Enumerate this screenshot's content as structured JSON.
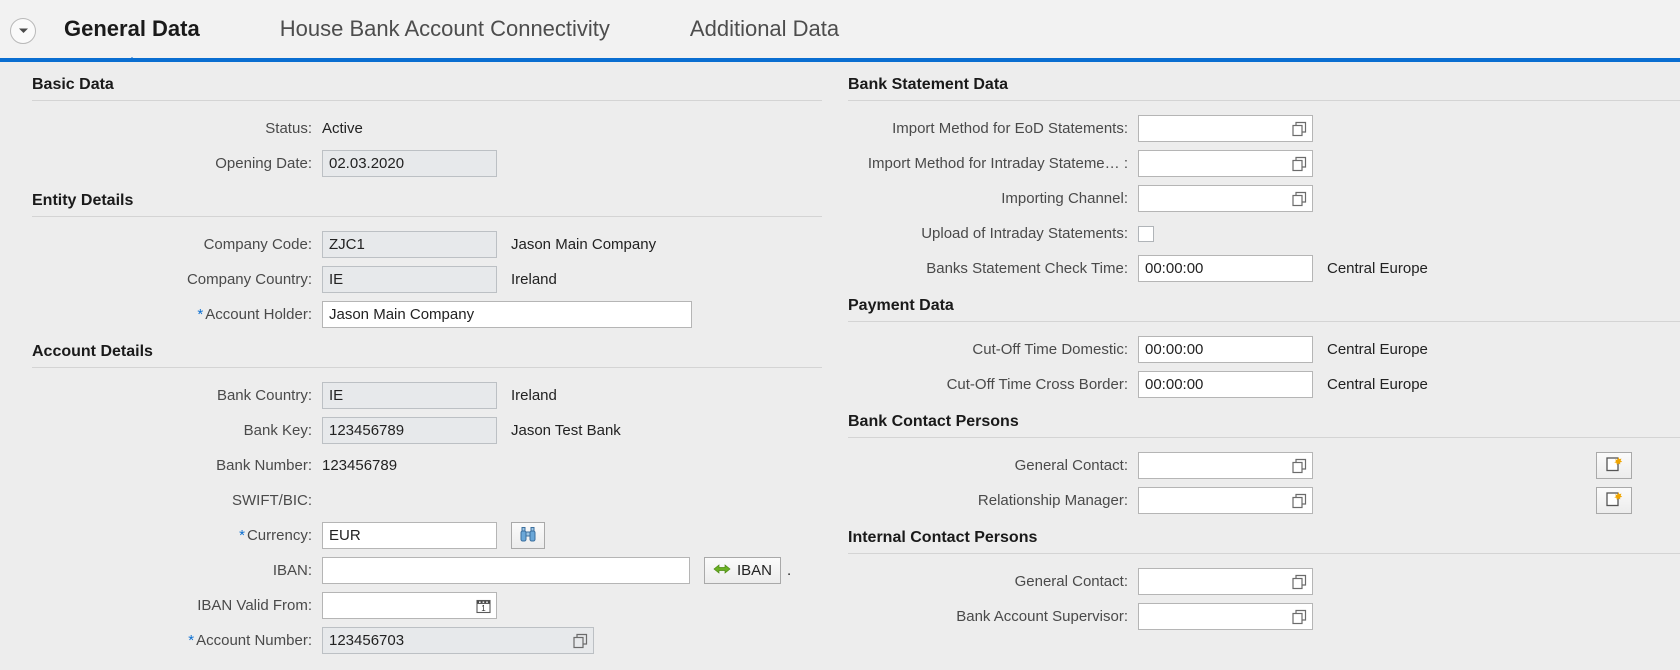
{
  "tabs": [
    {
      "label": "General Data",
      "active": true
    },
    {
      "label": "House Bank Account Connectivity",
      "active": false
    },
    {
      "label": "Additional Data",
      "active": false
    }
  ],
  "left": {
    "basic_data": {
      "heading": "Basic Data",
      "status_label": "Status:",
      "status_value": "Active",
      "opening_date_label": "Opening Date:",
      "opening_date_value": "02.03.2020"
    },
    "entity_details": {
      "heading": "Entity Details",
      "company_code_label": "Company Code:",
      "company_code_value": "ZJC1",
      "company_code_desc": "Jason Main Company",
      "company_country_label": "Company Country:",
      "company_country_value": "IE",
      "company_country_desc": "Ireland",
      "account_holder_label": "Account Holder:",
      "account_holder_value": "Jason Main Company",
      "account_holder_required": "*"
    },
    "account_details": {
      "heading": "Account Details",
      "bank_country_label": "Bank Country:",
      "bank_country_value": "IE",
      "bank_country_desc": "Ireland",
      "bank_key_label": "Bank Key:",
      "bank_key_value": "123456789",
      "bank_key_desc": "Jason Test Bank",
      "bank_number_label": "Bank Number:",
      "bank_number_value": "123456789",
      "swift_label": "SWIFT/BIC:",
      "swift_value": "",
      "currency_label": "Currency:",
      "currency_value": "EUR",
      "currency_required": "*",
      "iban_label": "IBAN:",
      "iban_value": "",
      "iban_button_label": "IBAN",
      "iban_trailing_text": ".",
      "iban_valid_from_label": "IBAN Valid From:",
      "iban_valid_from_value": "",
      "account_number_label": "Account Number:",
      "account_number_value": "123456703",
      "account_number_required": "*"
    }
  },
  "right": {
    "bank_statement_data": {
      "heading": "Bank Statement Data",
      "import_eod_label": "Import Method for EoD Statements:",
      "import_eod_value": "",
      "import_intraday_label": "Import Method for Intraday Stateme… :",
      "import_intraday_value": "",
      "importing_channel_label": "Importing Channel:",
      "importing_channel_value": "",
      "upload_intraday_label": "Upload of Intraday Statements:",
      "upload_intraday_checked": false,
      "check_time_label": "Banks Statement Check Time:",
      "check_time_value": "00:00:00",
      "check_time_zone": "Central Europe"
    },
    "payment_data": {
      "heading": "Payment Data",
      "cutoff_domestic_label": "Cut-Off Time Domestic:",
      "cutoff_domestic_value": "00:00:00",
      "cutoff_domestic_zone": "Central Europe",
      "cutoff_cross_label": "Cut-Off Time Cross Border:",
      "cutoff_cross_value": "00:00:00",
      "cutoff_cross_zone": "Central Europe"
    },
    "bank_contact_persons": {
      "heading": "Bank Contact Persons",
      "general_contact_label": "General Contact:",
      "general_contact_value": "",
      "relationship_manager_label": "Relationship Manager:",
      "relationship_manager_value": ""
    },
    "internal_contact_persons": {
      "heading": "Internal Contact Persons",
      "general_contact_label": "General Contact:",
      "general_contact_value": "",
      "supervisor_label": "Bank Account Supervisor:",
      "supervisor_value": ""
    }
  },
  "colors": {
    "accent": "#0a6ed1",
    "page_bg": "#ededed",
    "readonly_field": "#e7e9eb",
    "required_star": "#0a6ed1",
    "note_icon_star": "#f0a500",
    "iban_arrow": "#6ab023"
  }
}
